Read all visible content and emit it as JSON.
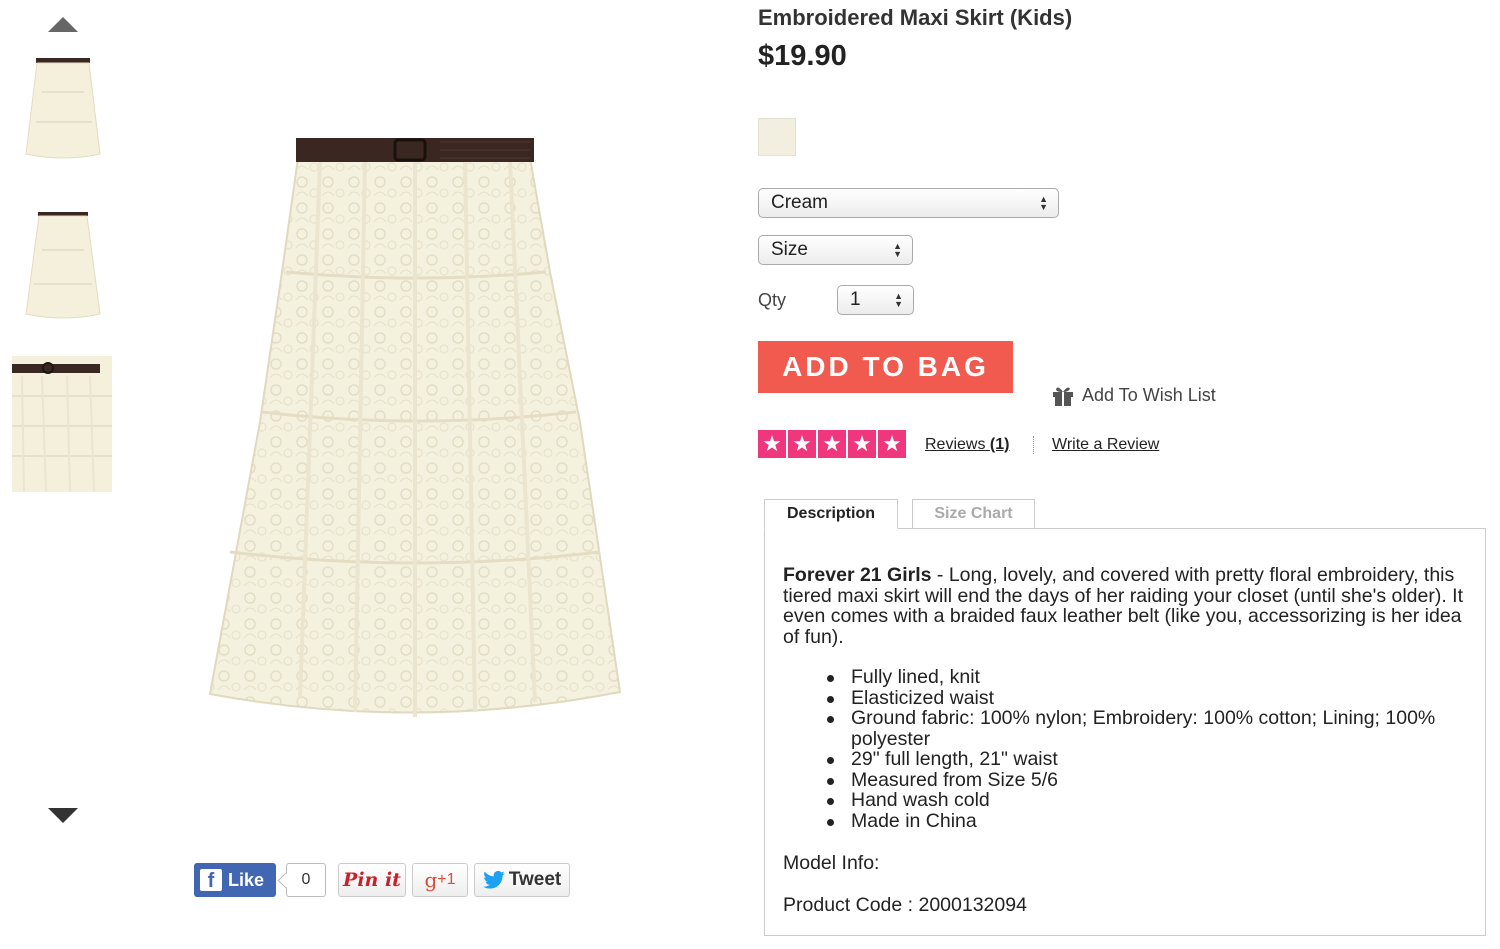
{
  "product": {
    "title": "Embroidered Maxi Skirt (Kids)",
    "price": "$19.90"
  },
  "options": {
    "color_value": "Cream",
    "size_value": "Size",
    "qty_label": "Qty",
    "qty_value": "1"
  },
  "actions": {
    "add_to_bag": "ADD TO BAG",
    "wish_list": "Add To Wish List"
  },
  "rating": {
    "stars": 5,
    "reviews_label": "Reviews",
    "reviews_count": "(1)",
    "write_review": "Write a Review"
  },
  "tabs": {
    "description": "Description",
    "size_chart": "Size Chart"
  },
  "description": {
    "brand": "Forever 21 Girls",
    "text": " - Long, lovely, and covered with pretty floral embroidery, this tiered maxi skirt will end the days of her raiding your closet (until she's older). It even comes with a braided faux leather belt (like you, accessorizing is her idea of fun).",
    "bullets": [
      "Fully lined, knit",
      "Elasticized waist",
      "Ground fabric: 100% nylon; Embroidery: 100% cotton; Lining; 100% polyester",
      "29\" full length, 21\" waist",
      "Measured from Size 5/6",
      "Hand wash cold",
      "Made in China"
    ],
    "model_info": "Model Info:",
    "product_code": "Product Code : 2000132094"
  },
  "social": {
    "like": "Like",
    "like_count": "0",
    "pin": "Pin it",
    "gplus": "+1",
    "tweet": "Tweet"
  },
  "colors": {
    "add_to_bag_bg": "#f15a4f",
    "star_pink": "#f0367d",
    "swatch_cream": "#f3efe0",
    "facebook_blue": "#4267b2"
  }
}
